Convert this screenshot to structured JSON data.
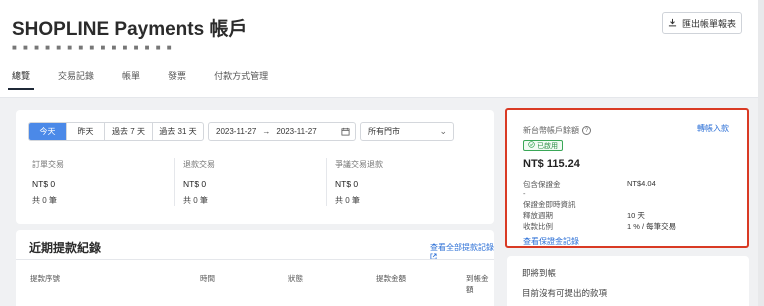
{
  "header": {
    "title": "SHOPLINE Payments 帳戶",
    "account_masked": "■ ■ ■ ■ ■ ■ ■ ■ ■ ■ ■ ■ ■ ■ ■",
    "export_label": "匯出帳單報表"
  },
  "tabs": [
    {
      "label": "總覽",
      "active": true
    },
    {
      "label": "交易記錄",
      "active": false
    },
    {
      "label": "帳單",
      "active": false
    },
    {
      "label": "發票",
      "active": false
    },
    {
      "label": "付款方式管理",
      "active": false
    }
  ],
  "filters": {
    "quick_ranges": [
      "今天",
      "昨天",
      "過去 7 天",
      "過去 31 天"
    ],
    "selected_range": "今天",
    "date_start": "2023-11-27",
    "date_end": "2023-11-27",
    "store_select": "所有門市"
  },
  "stats": [
    {
      "label": "訂單交易",
      "value": "NT$ 0",
      "count": "共 0 筆"
    },
    {
      "label": "退款交易",
      "value": "NT$ 0",
      "count": "共 0 筆"
    },
    {
      "label": "爭議交易退款",
      "value": "NT$ 0",
      "count": "共 0 筆"
    }
  ],
  "payouts": {
    "title": "近期提款紀錄",
    "view_all": "查看全部提款記錄",
    "columns": [
      "提款序號",
      "時間",
      "狀態",
      "提款金額",
      "到帳金額"
    ]
  },
  "account": {
    "label": "新台幣帳戶餘額",
    "transfer_in": "轉帳入款",
    "status": "已啟用",
    "balance": "NT$ 115.24",
    "rows": [
      {
        "label": "包含保證金",
        "value": "NT$4.04"
      },
      {
        "label": "-",
        "value": ""
      },
      {
        "label": "保證金即時資訊",
        "value": ""
      },
      {
        "label": "釋放週期",
        "value": "10 天"
      },
      {
        "label": "收款比例",
        "value": "1 % / 每筆交易"
      }
    ],
    "guarantee_link": "查看保證金記錄"
  },
  "pending": {
    "title": "即將到帳",
    "empty_text": "目前沒有可提出的款項"
  },
  "colors": {
    "accent": "#4b89e8",
    "link": "#2b6fd6",
    "highlight_border": "#d93a24",
    "active_badge": "#3aa757"
  }
}
